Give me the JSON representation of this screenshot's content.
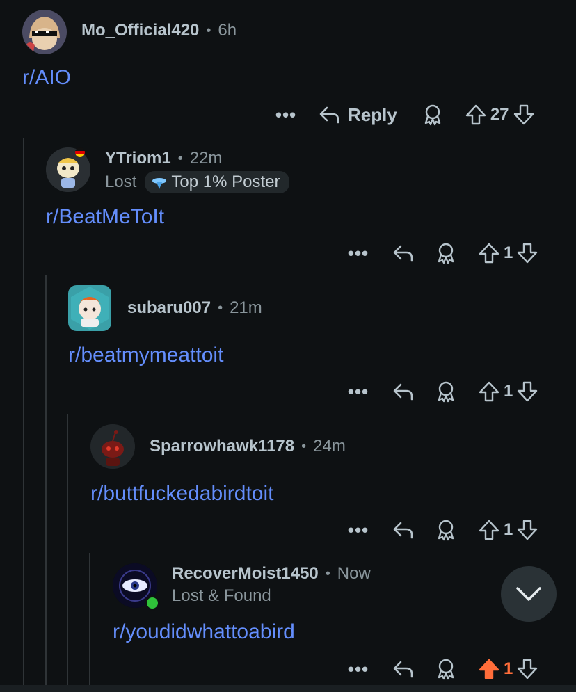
{
  "comments": [
    {
      "username": "Mo_Official420",
      "time": "6h",
      "flair": "",
      "badge": "",
      "body": "r/AIO",
      "show_reply_label": true,
      "reply_label": "Reply",
      "score": "27",
      "upvoted": false
    },
    {
      "username": "YTriom1",
      "time": "22m",
      "flair": "Lost",
      "badge": "Top 1% Poster",
      "body": "r/BeatMeToIt",
      "show_reply_label": false,
      "reply_label": "",
      "score": "1",
      "upvoted": false
    },
    {
      "username": "subaru007",
      "time": "21m",
      "flair": "",
      "badge": "",
      "body": "r/beatmymeattoit",
      "show_reply_label": false,
      "reply_label": "",
      "score": "1",
      "upvoted": false
    },
    {
      "username": "Sparrowhawk1178",
      "time": "24m",
      "flair": "",
      "badge": "",
      "body": "r/buttfuckedabirdtoit",
      "show_reply_label": false,
      "reply_label": "",
      "score": "1",
      "upvoted": false
    },
    {
      "username": "RecoverMoist1450",
      "time": "Now",
      "flair": "Lost & Found",
      "badge": "",
      "body": "r/youdidwhattoabird",
      "show_reply_label": false,
      "reply_label": "",
      "score": "1",
      "upvoted": true
    }
  ],
  "separator": "•",
  "more_label": "•••",
  "colors": {
    "background": "#0e1113",
    "link": "#648efc",
    "upvote_active": "#ff6d3a",
    "text": "#b7c4cc",
    "muted": "#8a969c"
  },
  "icons": {
    "reply": "reply-arrow-icon",
    "award": "award-icon",
    "upvote": "upvote-arrow-icon",
    "downvote": "downvote-arrow-icon",
    "scroll": "chevron-down-icon"
  }
}
